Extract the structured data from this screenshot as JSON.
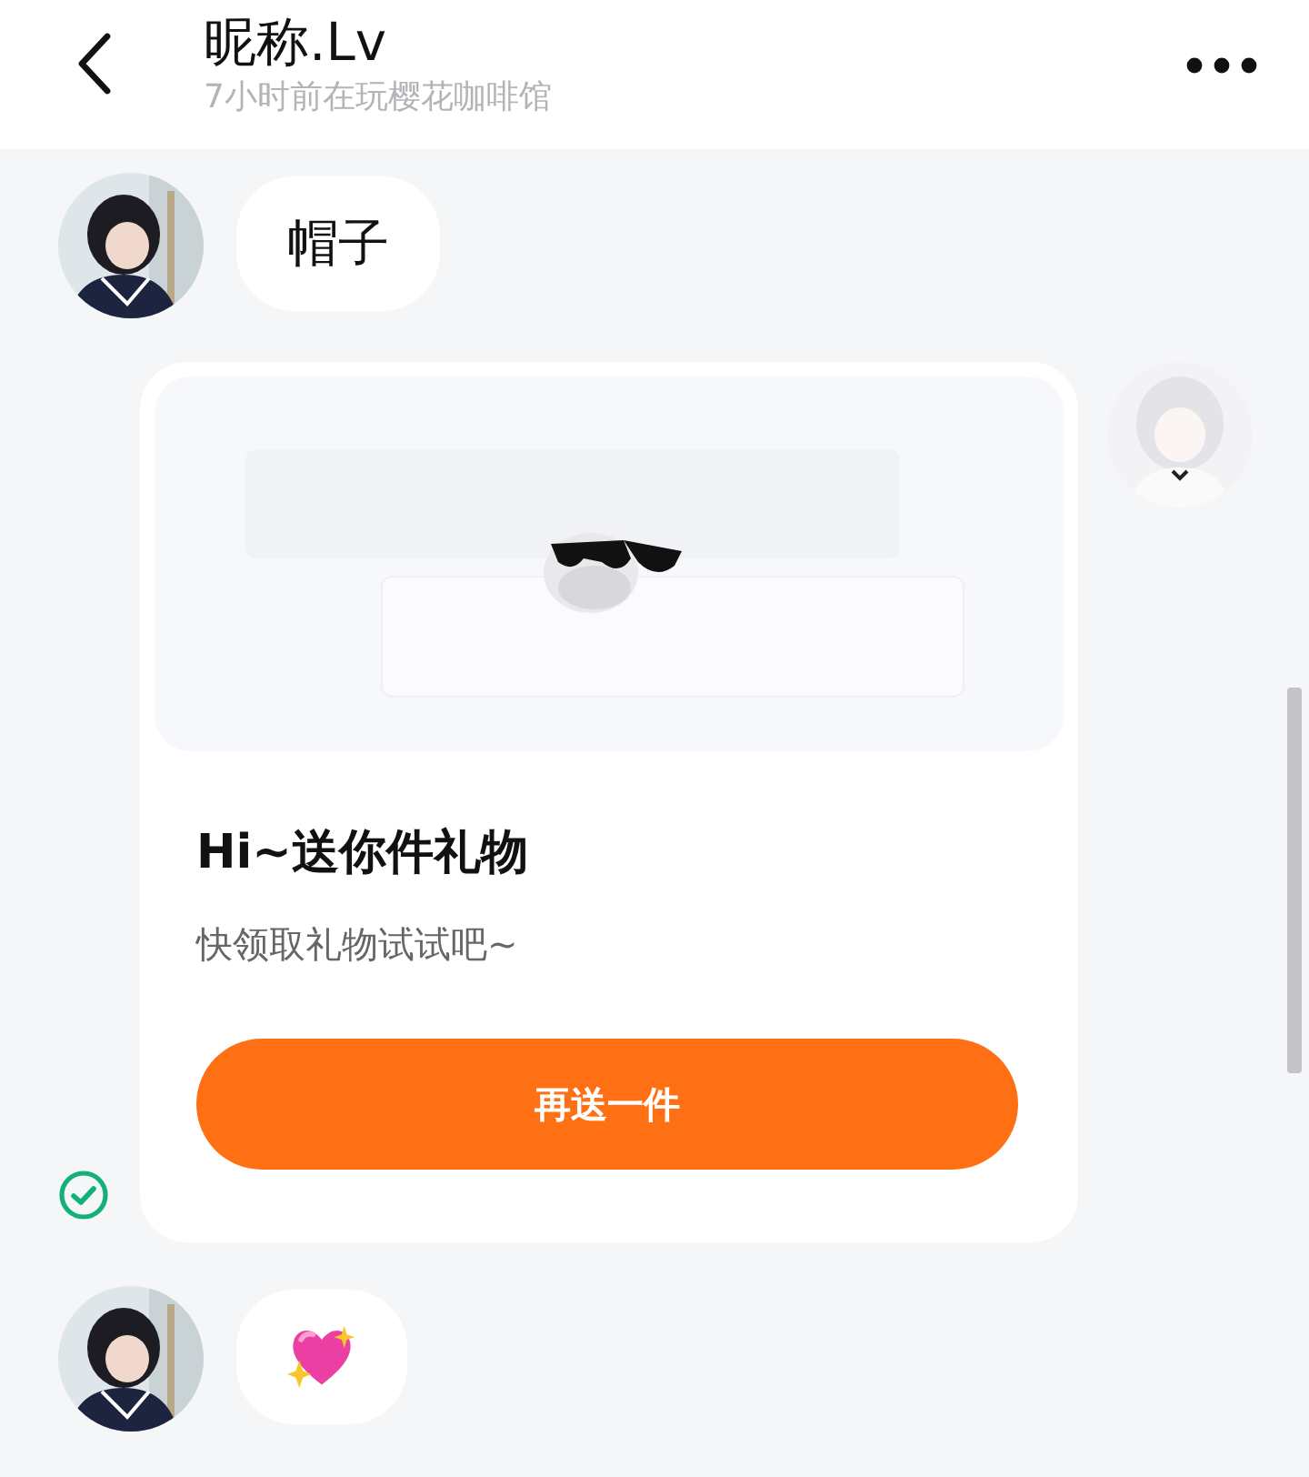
{
  "header": {
    "title": "昵称.Lv",
    "subtitle": "7小时前在玩樱花咖啡馆"
  },
  "messages": [
    {
      "kind": "text",
      "outgoing": false,
      "text": "帽子",
      "read": false
    },
    {
      "kind": "gift",
      "outgoing": true,
      "title": "Hi~送你件礼物",
      "subtitle": "快领取礼物试试吧~",
      "button": "再送一件",
      "read": true
    },
    {
      "kind": "emoji",
      "outgoing": false,
      "read": false
    }
  ]
}
